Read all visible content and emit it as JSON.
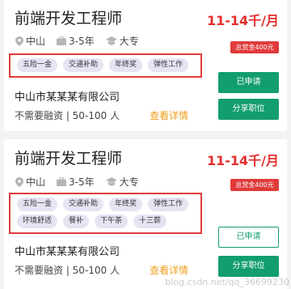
{
  "colors": {
    "salary": "#e62e2e",
    "bonus_bg": "#e03a3a",
    "tag_bg": "#e6e4f3",
    "highlight_border": "#e03c3c",
    "primary_green": "#129e6f",
    "link_orange": "#f0a020"
  },
  "jobs": [
    {
      "title": "前端开发工程师",
      "salary": "11-14千/月",
      "location": "中山",
      "experience": "3-5年",
      "education": "大专",
      "bonus": "总赏金400元",
      "tags": [
        "五险一金",
        "交通补助",
        "年终奖",
        "弹性工作"
      ],
      "company": "中山市某某某有限公司",
      "detail": "不需要融资 | 50-100 人",
      "view_label": "查看详情",
      "applied_label": "已申请",
      "share_label": "分享职位",
      "icons": [
        "location-pin-icon",
        "briefcase-icon",
        "graduation-cap-icon"
      ]
    },
    {
      "title": "前端开发工程师",
      "salary": "11-14千/月",
      "location": "中山",
      "experience": "3-5年",
      "education": "大专",
      "bonus": "总赏金400元",
      "tags": [
        "五险一金",
        "交通补助",
        "年终奖",
        "弹性工作"
      ],
      "tags_row2": [
        "环境舒适",
        "餐补",
        "下午茶",
        "十三薪"
      ],
      "company": "中山市某某某有限公司",
      "detail": "不需要融资 | 50-100 人",
      "view_label": "查看详情",
      "applied_label": "已申请",
      "share_label": "分享职位",
      "icons": [
        "location-pin-icon",
        "briefcase-icon",
        "graduation-cap-icon"
      ]
    }
  ],
  "watermark": "blog.csdn.net/qq_36699230"
}
